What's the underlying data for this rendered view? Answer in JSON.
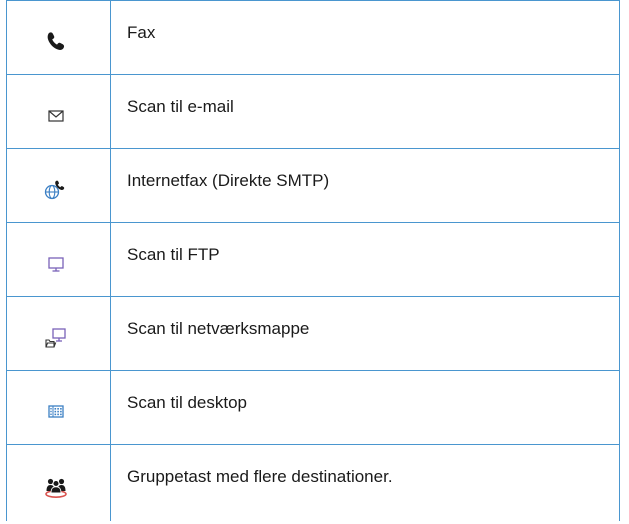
{
  "colors": {
    "border": "#4a96cf",
    "icon_dark": "#1a1a1a",
    "icon_blue": "#3b7fc4",
    "icon_purple": "#7a62b8",
    "icon_red": "#d9534f"
  },
  "rows": [
    {
      "icon": "phone-icon",
      "label": "Fax"
    },
    {
      "icon": "envelope-icon",
      "label": "Scan til e-mail"
    },
    {
      "icon": "globe-phone-icon",
      "label": "Internetfax (Direkte SMTP)"
    },
    {
      "icon": "monitor-icon",
      "label": "Scan til FTP"
    },
    {
      "icon": "network-folder-icon",
      "label": "Scan til netværksmappe"
    },
    {
      "icon": "desktop-grid-icon",
      "label": "Scan til desktop"
    },
    {
      "icon": "group-icon",
      "label": "Gruppetast med flere destinationer."
    }
  ]
}
